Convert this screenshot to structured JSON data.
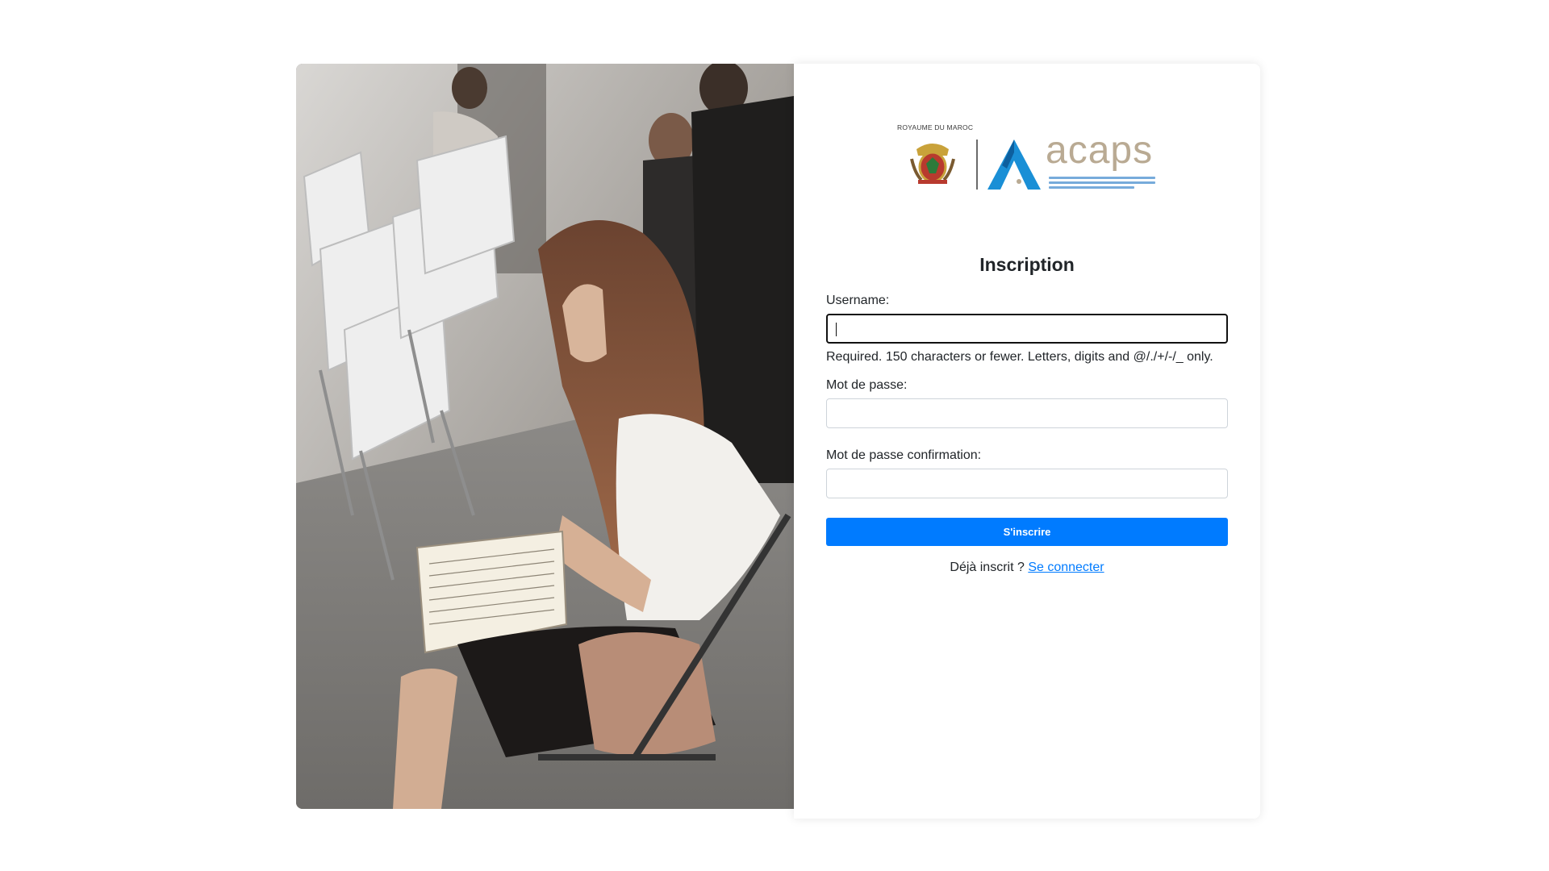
{
  "logo": {
    "royaume_text": "ROYAUME DU MAROC",
    "brand_name": "acaps",
    "brand_color": "#b9aa93",
    "mark_color": "#1a8fd6"
  },
  "form": {
    "title": "Inscription",
    "username": {
      "label": "Username:",
      "value": "",
      "help": "Required. 150 characters or fewer. Letters, digits and @/./+/-/_ only."
    },
    "password": {
      "label": "Mot de passe:",
      "value": ""
    },
    "password_confirm": {
      "label": "Mot de passe confirmation:",
      "value": ""
    },
    "submit_label": "S'inscrire",
    "submit_color": "#007bff"
  },
  "footer": {
    "prompt": "Déjà inscrit ? ",
    "login_link": "Se connecter"
  }
}
